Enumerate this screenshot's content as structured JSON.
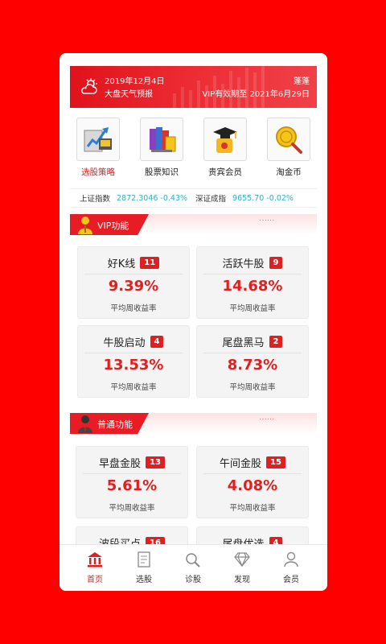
{
  "banner": {
    "date": "2019年12月4日",
    "forecast": "大盘天气预报",
    "user": "蓬蓬",
    "vip": "VIP有效期至 2021年6月29日"
  },
  "quick": [
    {
      "label": "选股策略",
      "icon": "strategy-icon",
      "active": true
    },
    {
      "label": "股票知识",
      "icon": "books-icon",
      "active": false
    },
    {
      "label": "贵宾会员",
      "icon": "graduate-icon",
      "active": false
    },
    {
      "label": "淘金币",
      "icon": "coin-search-icon",
      "active": false
    }
  ],
  "indices": {
    "sh_name": "上证指数",
    "sh_value": "2872.3046 -0.43%",
    "sz_name": "深证成指",
    "sz_value": "9655.70 -0.02%"
  },
  "sections": {
    "vip": {
      "title": "VIP功能",
      "dots": "······"
    },
    "normal": {
      "title": "普通功能",
      "dots": "······"
    }
  },
  "cards": [
    {
      "name": "好K线",
      "count": "11",
      "pct": "9.39%",
      "sub": "平均周收益率"
    },
    {
      "name": "活跃牛股",
      "count": "9",
      "pct": "14.68%",
      "sub": "平均周收益率"
    },
    {
      "name": "牛股启动",
      "count": "4",
      "pct": "13.53%",
      "sub": "平均周收益率"
    },
    {
      "name": "尾盘黑马",
      "count": "2",
      "pct": "8.73%",
      "sub": "平均周收益率"
    },
    {
      "name": "早盘金股",
      "count": "13",
      "pct": "5.61%",
      "sub": "平均周收益率"
    },
    {
      "name": "午间金股",
      "count": "15",
      "pct": "4.08%",
      "sub": "平均周收益率"
    },
    {
      "name": "波段买点",
      "count": "16",
      "pct": "",
      "sub": ""
    },
    {
      "name": "尾盘优选",
      "count": "4",
      "pct": "",
      "sub": ""
    }
  ],
  "nav": [
    {
      "label": "首页",
      "icon": "bank-icon",
      "active": true
    },
    {
      "label": "选股",
      "icon": "document-icon",
      "active": false
    },
    {
      "label": "诊股",
      "icon": "magnifier-icon",
      "active": false
    },
    {
      "label": "发现",
      "icon": "diamond-icon",
      "active": false
    },
    {
      "label": "会员",
      "icon": "user-icon",
      "active": false
    }
  ],
  "colors": {
    "brand": "#e02020",
    "background": "#ff0000",
    "index_value": "#2bb0c4"
  }
}
